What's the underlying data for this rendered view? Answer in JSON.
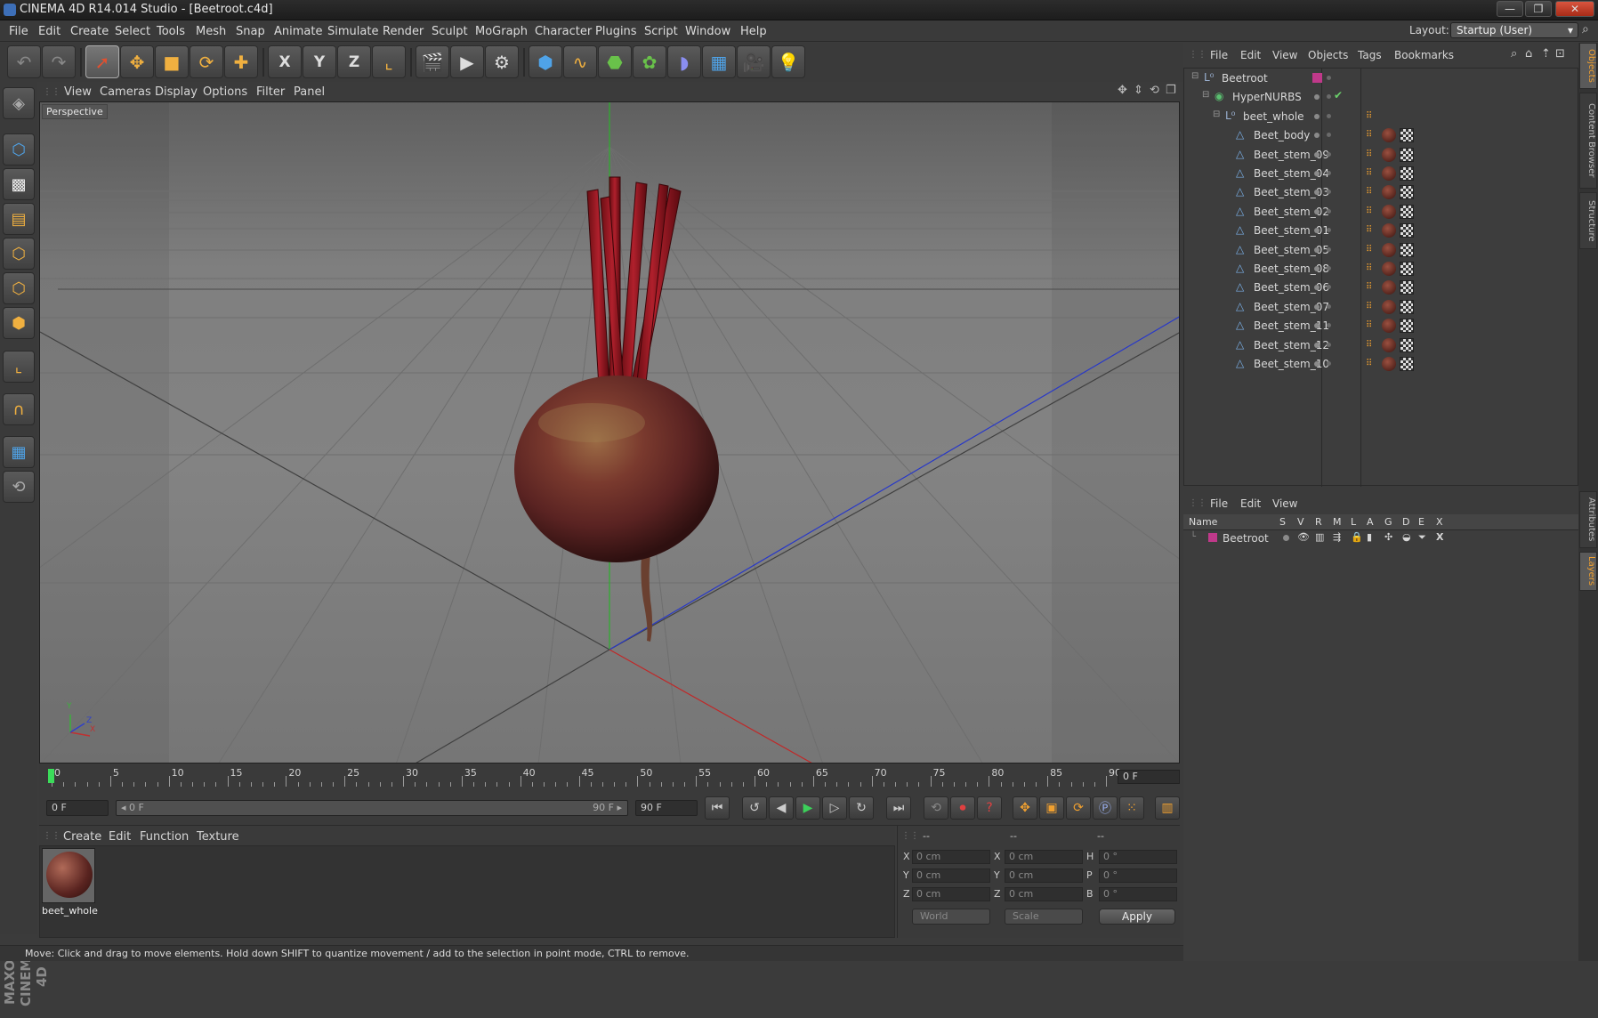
{
  "window": {
    "title": "CINEMA 4D R14.014 Studio - [Beetroot.c4d]",
    "minimize": "—",
    "maximize": "❐",
    "close": "✕"
  },
  "menubar": {
    "items": [
      "File",
      "Edit",
      "Create",
      "Select",
      "Tools",
      "Mesh",
      "Snap",
      "Animate",
      "Simulate",
      "Render",
      "Sculpt",
      "MoGraph",
      "Character",
      "Plugins",
      "Script",
      "Window",
      "Help"
    ],
    "layout_label": "Layout:",
    "layout_value": "Startup (User)"
  },
  "toolbar": {
    "icons": [
      "undo-icon",
      "redo-icon",
      "live-selection-icon",
      "move-icon",
      "scale-icon",
      "rotate-icon",
      "add-object-icon",
      "x-axis-icon",
      "y-axis-icon",
      "z-axis-icon",
      "world-coordinates-icon",
      "render-view-icon",
      "render-picture-viewer-icon",
      "render-settings-icon",
      "cube-primitive-icon",
      "spline-icon",
      "nurbs-icon",
      "mograph-cloner-icon",
      "deformer-icon",
      "floor-scene-icon",
      "camera-icon",
      "light-icon"
    ],
    "axis_labels": [
      "X",
      "Y",
      "Z"
    ]
  },
  "left_tools": [
    "make-editable-icon",
    "model-mode-icon",
    "texture-mode-icon",
    "workplane-icon",
    "points-mode-icon",
    "edges-mode-icon",
    "polygons-mode-icon",
    "axis-mode-icon",
    "magnet-icon",
    "snap-icon",
    "lock-workplane-icon"
  ],
  "viewport": {
    "menu": [
      "View",
      "Cameras",
      "Display",
      "Options",
      "Filter",
      "Panel"
    ],
    "label": "Perspective",
    "axis_x": "X",
    "axis_y": "Y",
    "axis_z": "Z"
  },
  "timeline": {
    "ticks": [
      "0",
      "5",
      "10",
      "15",
      "20",
      "25",
      "30",
      "35",
      "40",
      "45",
      "50",
      "55",
      "60",
      "65",
      "70",
      "75",
      "80",
      "85",
      "90"
    ],
    "current_frame": "0 F"
  },
  "transport": {
    "start_field": "0 F",
    "range_start": "◂ 0 F",
    "range_end": "90 F ▸",
    "end_field": "90 F"
  },
  "material_manager": {
    "menu": [
      "Create",
      "Edit",
      "Function",
      "Texture"
    ],
    "materials": [
      {
        "name": "beet_whole"
      }
    ]
  },
  "coordinates": {
    "headers": [
      "--",
      "--",
      "--"
    ],
    "rows": [
      {
        "a_label": "X",
        "a": "0 cm",
        "b_label": "X",
        "b": "0 cm",
        "c_label": "H",
        "c": "0 °"
      },
      {
        "a_label": "Y",
        "a": "0 cm",
        "b_label": "Y",
        "b": "0 cm",
        "c_label": "P",
        "c": "0 °"
      },
      {
        "a_label": "Z",
        "a": "0 cm",
        "b_label": "Z",
        "b": "0 cm",
        "c_label": "B",
        "c": "0 °"
      }
    ],
    "mode_world": "World",
    "mode_scale": "Scale",
    "apply": "Apply"
  },
  "status": "Move: Click and drag to move elements. Hold down SHIFT to quantize movement / add to the selection in point mode, CTRL to remove.",
  "object_manager": {
    "menu": [
      "File",
      "Edit",
      "View",
      "Objects",
      "Tags",
      "Bookmarks"
    ],
    "objects": [
      {
        "name": "Beetroot",
        "indent": 0
      },
      {
        "name": "HyperNURBS",
        "indent": 1
      },
      {
        "name": "beet_whole",
        "indent": 2
      },
      {
        "name": "Beet_body",
        "indent": 3
      },
      {
        "name": "Beet_stem_09",
        "indent": 3
      },
      {
        "name": "Beet_stem_04",
        "indent": 3
      },
      {
        "name": "Beet_stem_03",
        "indent": 3
      },
      {
        "name": "Beet_stem_02",
        "indent": 3
      },
      {
        "name": "Beet_stem_01",
        "indent": 3
      },
      {
        "name": "Beet_stem_05",
        "indent": 3
      },
      {
        "name": "Beet_stem_08",
        "indent": 3
      },
      {
        "name": "Beet_stem_06",
        "indent": 3
      },
      {
        "name": "Beet_stem_07",
        "indent": 3
      },
      {
        "name": "Beet_stem_11",
        "indent": 3
      },
      {
        "name": "Beet_stem_12",
        "indent": 3
      },
      {
        "name": "Beet_stem_10",
        "indent": 3
      }
    ]
  },
  "layer_manager": {
    "menu": [
      "File",
      "Edit",
      "View"
    ],
    "columns": [
      "Name",
      "S",
      "V",
      "R",
      "M",
      "L",
      "A",
      "G",
      "D",
      "E",
      "X"
    ],
    "layers": [
      {
        "name": "Beetroot",
        "color": "#c0398a"
      }
    ]
  },
  "right_tabs": [
    "Objects",
    "Content Browser",
    "Structure",
    "Attributes",
    "Layers"
  ],
  "colors": {
    "accent": "#f0a030",
    "viewport_grid": "#5a5a5a",
    "axis_x": "#c03030",
    "axis_y": "#30b030",
    "axis_z": "#3040c8"
  }
}
